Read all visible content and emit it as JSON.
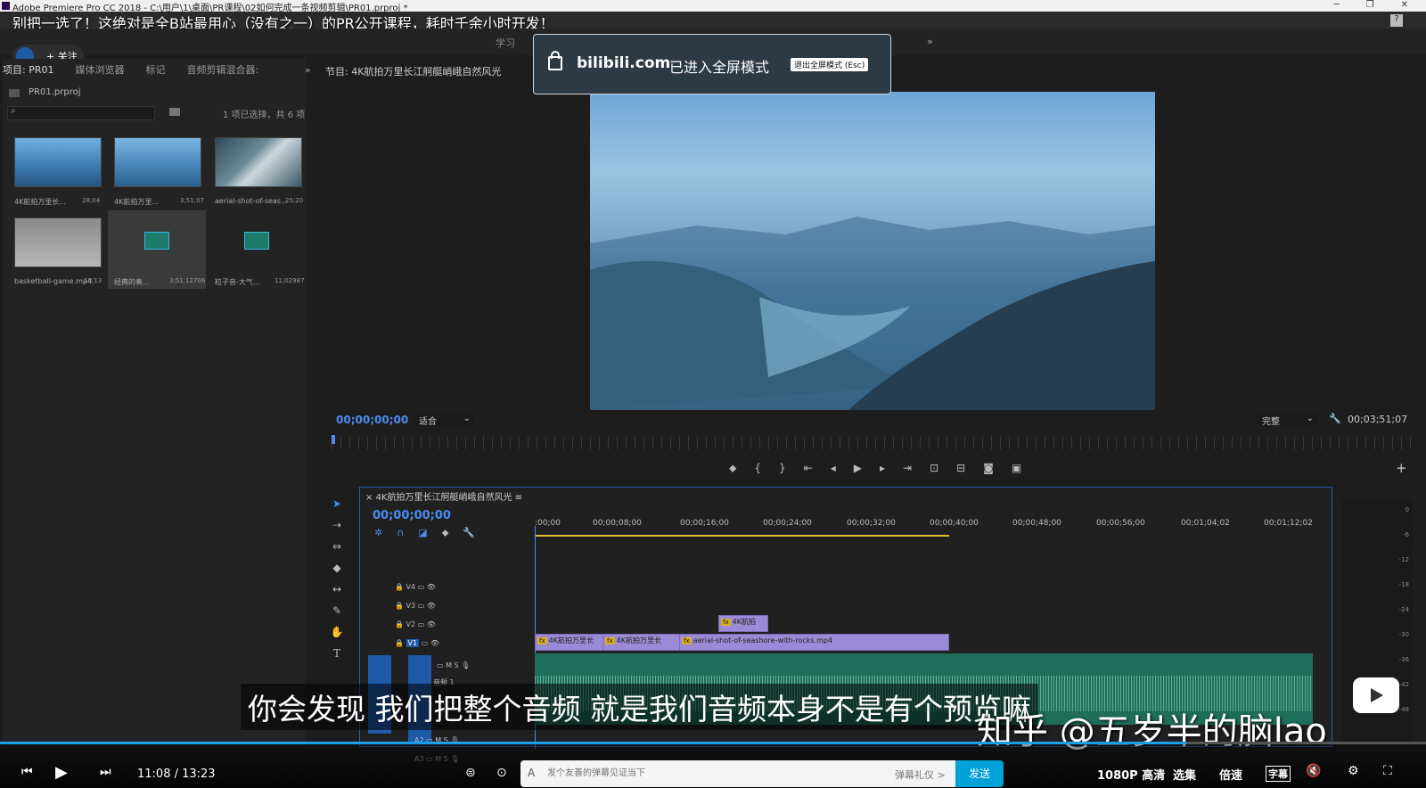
{
  "app": {
    "title": "Adobe Premiere Pro CC 2018 - C:\\用户\\1\\桌面\\PR课程\\02如何完成一条视频剪辑\\PR01.prproj *"
  },
  "danmu_top": "别把一选了！这绝对是全B站最用心（没有之一）的PR公开课程，耗时千余小时开发！",
  "workspace": {
    "tab": "学习"
  },
  "follow": {
    "label": "+ 关注"
  },
  "project": {
    "tabs": [
      "项目: PR01",
      "媒体浏览器",
      "标记",
      "音频剪辑混合器:"
    ],
    "file": "PR01.prproj",
    "selection_info": "1 项已选择，共 6 项",
    "items": [
      {
        "name": "4K航拍万里长...",
        "duration": "28;04"
      },
      {
        "name": "4K航拍万里...",
        "duration": "3;51;07"
      },
      {
        "name": "aerial-shot-of-seas...",
        "duration": "25;20"
      },
      {
        "name": "basketball-game.mp4",
        "duration": "10;13"
      },
      {
        "name": "经典的奏...",
        "duration": "3;51;12706"
      },
      {
        "name": "粒子音-大气...",
        "duration": "11;02987"
      }
    ]
  },
  "program": {
    "tab": "节目: 4K航拍万里长江舸艇峭峨自然风光",
    "timecode": "00;00;00;00",
    "fit": "适合",
    "quality": "完整",
    "duration": "00;03;51;07"
  },
  "bili_fullscreen": {
    "domain": "bilibili.com",
    "message": "已进入全屏模式",
    "exit": "退出全屏模式 (Esc)"
  },
  "timeline": {
    "tab": "4K航拍万里长江舸艇峭峨自然风光",
    "timecode": "00;00;00;00",
    "ruler": [
      ":00;00",
      "00;00;08;00",
      "00;00;16;00",
      "00;00;24;00",
      "00;00;32;00",
      "00;00;40;00",
      "00;00;48;00",
      "00;00;56;00",
      "00;01;04;02",
      "00;01;12;02"
    ],
    "video_tracks": [
      "V4",
      "V3",
      "V2",
      "V1"
    ],
    "audio_tracks": [
      "A1",
      "A2",
      "A3"
    ],
    "audio_track_name": "音频 1",
    "clips": {
      "v2": "4K航拍",
      "v1a": "4K航拍万里长",
      "v1b": "4K航拍万里长",
      "v1c": "aerial-shot-of-seashore-with-rocks.mp4"
    }
  },
  "meter_labels": [
    "0",
    "-6",
    "-12",
    "-18",
    "-24",
    "-30",
    "-36",
    "-42",
    "-48"
  ],
  "subtitle": "你会发现 我们把整个音频 就是我们音频本身不是有个预览嘛",
  "watermark": "知乎 @五岁半的脑lao",
  "player": {
    "time": "11:08 / 13:23",
    "progress": 0.832,
    "danmu_placeholder": "发个友善的弹幕见证当下",
    "etiquette": "弹幕礼仪 >",
    "send": "发送",
    "quality": "1080P 高清",
    "episodes": "选集",
    "speed": "倍速",
    "subtitle_btn": "字幕"
  },
  "colors": {
    "accent": "#00a1d6",
    "timecode": "#4a8cf0",
    "clip": "#9b8ad8",
    "audio": "#1e6e5a"
  }
}
